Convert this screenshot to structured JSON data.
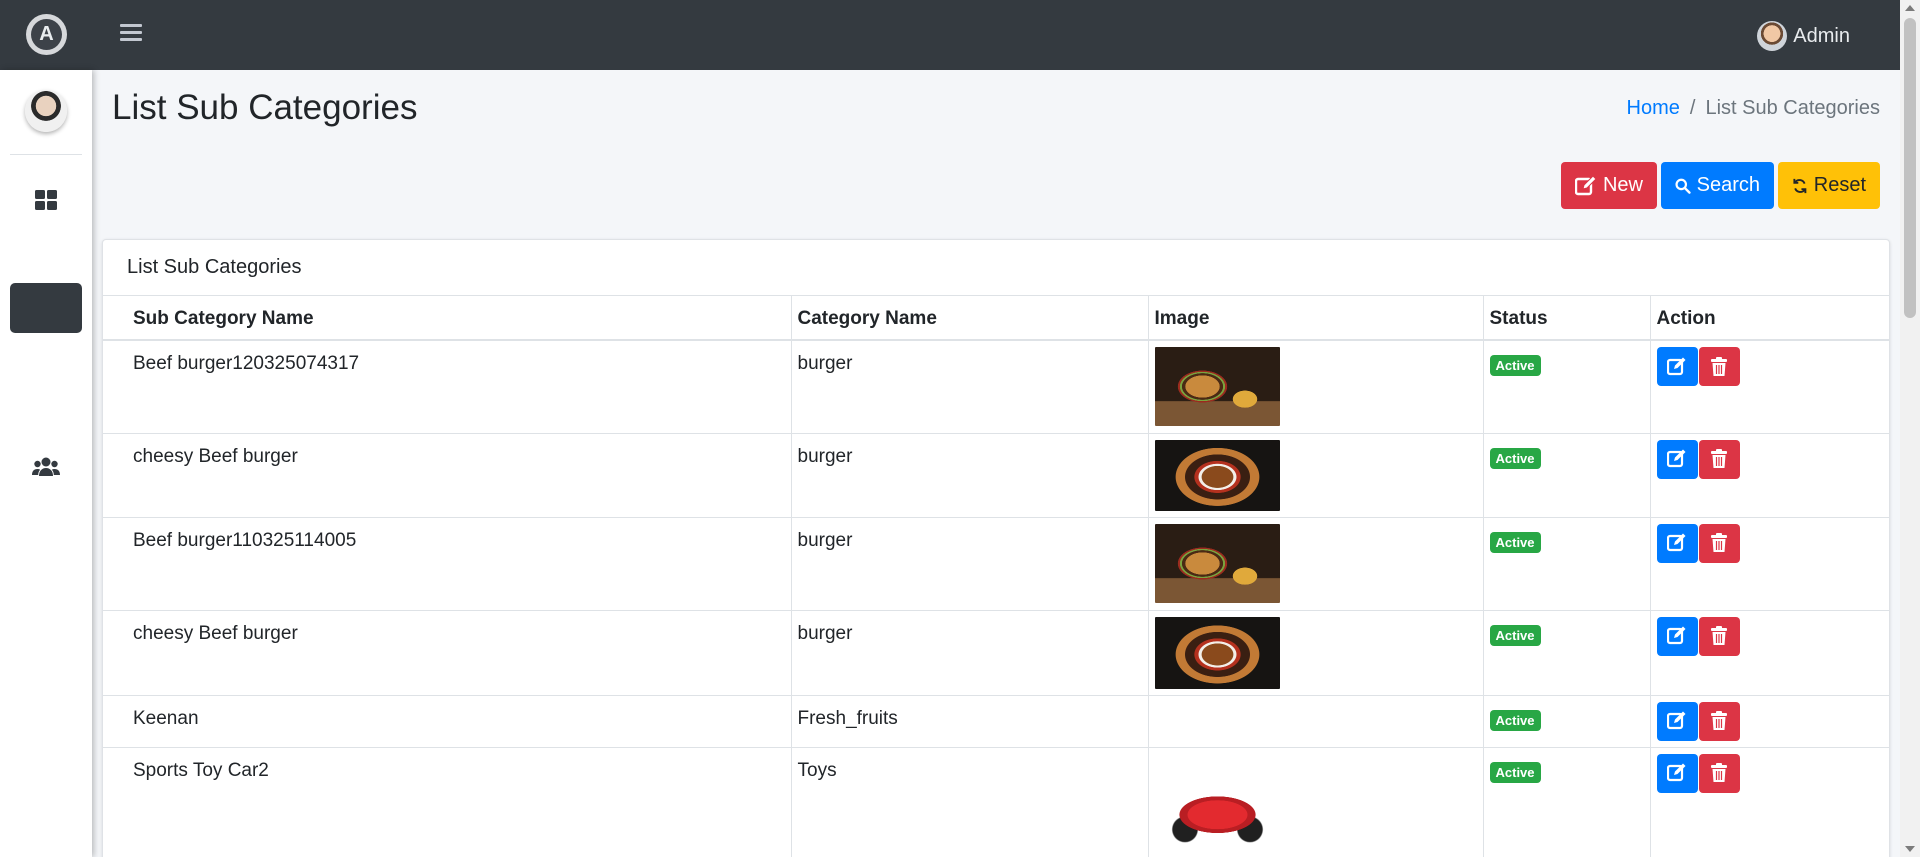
{
  "header": {
    "brand_letter": "A",
    "user_name": "Admin"
  },
  "sidebar": {
    "items": [
      {
        "icon": "dashboard-icon"
      },
      {
        "icon": "active-menu-item"
      },
      {
        "icon": "users-icon"
      }
    ]
  },
  "page": {
    "title": "List Sub Categories",
    "breadcrumb": {
      "home": "Home",
      "separator": "/",
      "current": "List Sub Categories"
    }
  },
  "toolbar": {
    "new_label": "New",
    "search_label": "Search",
    "reset_label": "Reset"
  },
  "card": {
    "title": "List Sub Categories"
  },
  "table": {
    "columns": [
      "Sub Category Name",
      "Category Name",
      "Image",
      "Status",
      "Action"
    ],
    "rows": [
      {
        "name": "Beef burger120325074317",
        "category": "burger",
        "image": "burger-with-fries",
        "status": "Active"
      },
      {
        "name": "cheesy Beef burger",
        "category": "burger",
        "image": "cheesy-burger",
        "status": "Active"
      },
      {
        "name": "Beef burger110325114005",
        "category": "burger",
        "image": "burger-with-fries",
        "status": "Active"
      },
      {
        "name": "cheesy Beef burger",
        "category": "burger",
        "image": "cheesy-burger",
        "status": "Active"
      },
      {
        "name": "Keenan",
        "category": "Fresh_fruits",
        "image": "",
        "status": "Active"
      },
      {
        "name": "Sports Toy Car2",
        "category": "Toys",
        "image": "red-toy-car",
        "status": "Active"
      }
    ]
  },
  "colors": {
    "navbar": "#343a40",
    "primary": "#007bff",
    "danger": "#dc3545",
    "warning": "#ffc107",
    "success": "#28a745"
  }
}
